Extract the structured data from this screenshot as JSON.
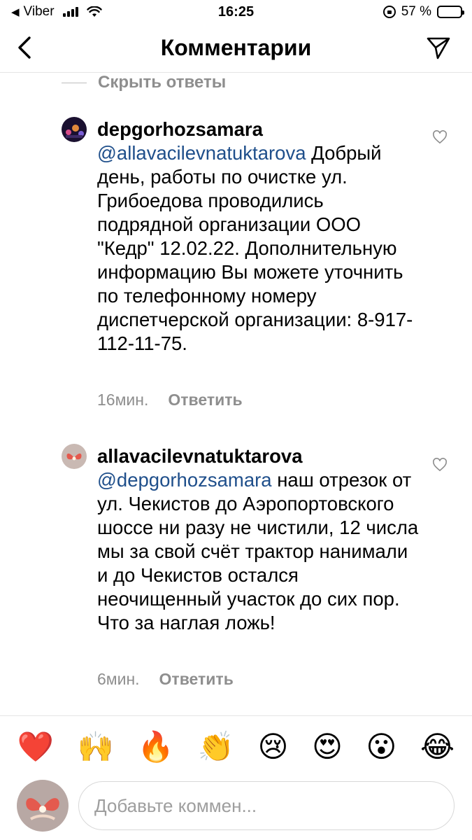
{
  "status_bar": {
    "carrier": "Viber",
    "time": "16:25",
    "battery": "57 %",
    "battery_level": 0.57
  },
  "header": {
    "title": "Комментарии"
  },
  "thread": {
    "hide_replies": "Скрыть ответы"
  },
  "comments": [
    {
      "username": "depgorhozsamara",
      "mention": "@allavacilevnatuktarova",
      "text": " Добрый день, работы по очистке ул. Грибоедова проводились подрядной организации ООО \"Кедр\" 12.02.22. Дополнительную информацию Вы можете уточнить по телефонному номеру диспетчерской организации: 8-917-112-11-75.",
      "time": "16мин.",
      "reply_label": "Ответить"
    },
    {
      "username": "allavacilevnatuktarova",
      "mention": "@depgorhozsamara",
      "text": " наш отрезок от ул. Чекистов до Аэропортовского шоссе ни разу не чистили, 12 числа мы за свой счёт трактор нанимали и до Чекистов остался неочищенный участок до сих пор. Что за наглая ложь!",
      "time": "6мин.",
      "reply_label": "Ответить"
    }
  ],
  "emoji_bar": [
    "❤️",
    "🙌",
    "🔥",
    "👏",
    "😢",
    "😍",
    "😮",
    "😂"
  ],
  "composer": {
    "placeholder": "Добавьте коммен..."
  },
  "colors": {
    "mention": "#1f4f8b",
    "secondary_text": "#8e8e8e",
    "divider": "#e5e5e5"
  }
}
